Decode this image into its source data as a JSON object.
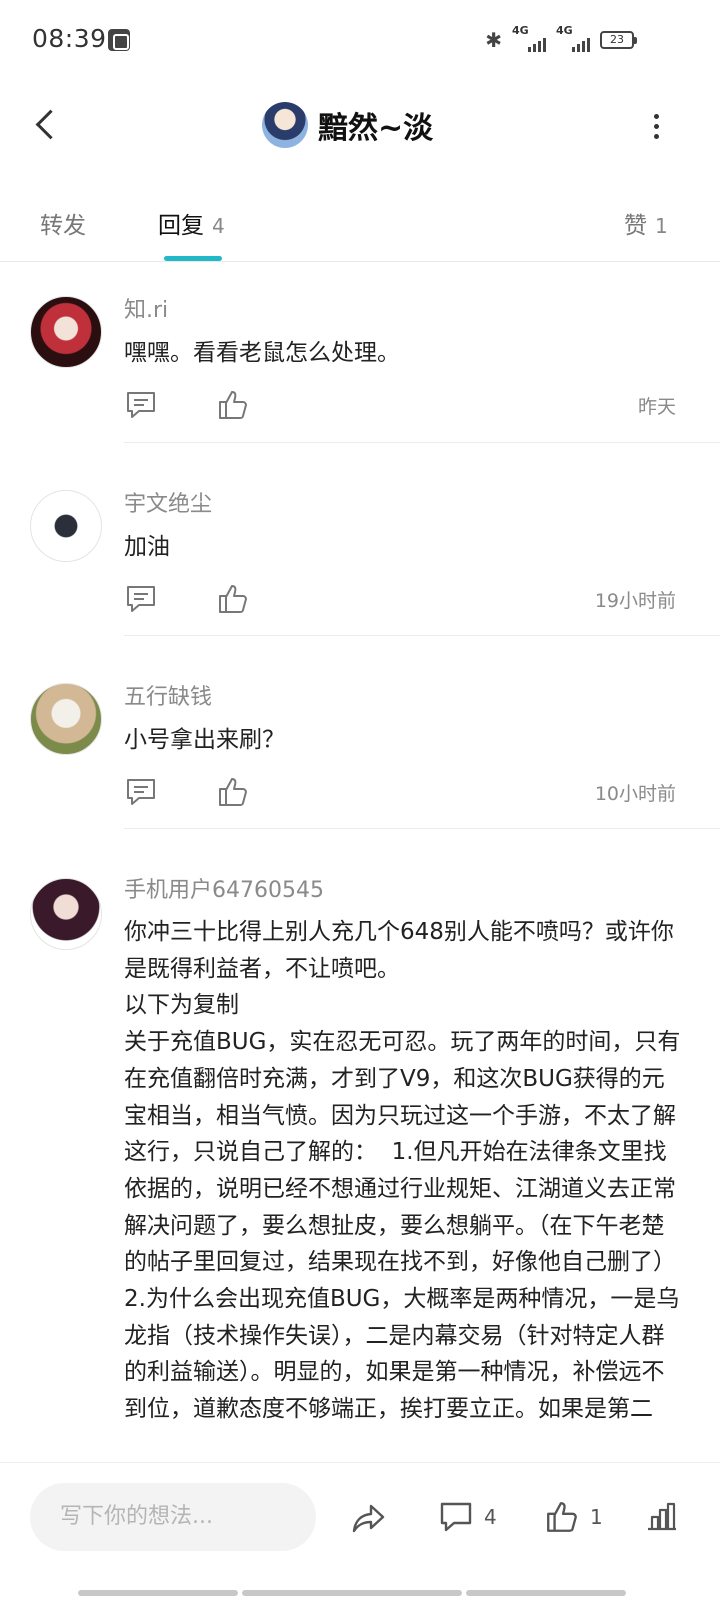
{
  "status_bar": {
    "time": "08:39",
    "signal1_label": "4G",
    "signal2_label": "4G",
    "battery": "23"
  },
  "header": {
    "title": "黯然~淡"
  },
  "tabs": [
    {
      "label": "转发",
      "count": ""
    },
    {
      "label": "回复",
      "count": "4"
    },
    {
      "label": "赞",
      "count": "1"
    }
  ],
  "comments": [
    {
      "name": "知.ri",
      "text": "嘿嘿。看看老鼠怎么处理。",
      "time": "昨天"
    },
    {
      "name": "宇文绝尘",
      "text": "加油",
      "time": "19小时前"
    },
    {
      "name": "五行缺钱",
      "text": "小号拿出来刷？",
      "time": "10小时前"
    },
    {
      "name": "手机用户64760545",
      "text": "你冲三十比得上别人充几个648别人能不喷吗？或许你是既得利益者，不让喷吧。\n以下为复制\n关于充值BUG，实在忍无可忍。玩了两年的时间，只有在充值翻倍时充满，才到了V9，和这次BUG获得的元宝相当，相当气愤。因为只玩过这一个手游，不太了解这行，只说自己了解的：  1.但凡开始在法律条文里找依据的，说明已经不想通过行业规矩、江湖道义去正常解决问题了，要么想扯皮，要么想躺平。（在下午老楚的帖子里回复过，结果现在找不到，好像他自己删了）  2.为什么会出现充值BUG，大概率是两种情况，一是乌龙指（技术操作失误），二是内幕交易（针对特定人群的利益输送）。明显的，如果是第一种情况，补偿远不到位，道歉态度不够端正，挨打要立正。如果是第二",
      "time": ""
    }
  ],
  "bottom_bar": {
    "input_placeholder": "写下你的想法...",
    "comment_count": "4",
    "like_count": "1"
  },
  "icons": {
    "back": "back-chevron-icon",
    "more": "more-vertical-icon",
    "reply": "comment-bubble-icon",
    "like": "thumbs-up-icon",
    "share": "share-arrow-icon",
    "stats": "bar-chart-icon"
  },
  "colors": {
    "accent": "#22b8c8",
    "muted_text": "#8a8a8a"
  }
}
